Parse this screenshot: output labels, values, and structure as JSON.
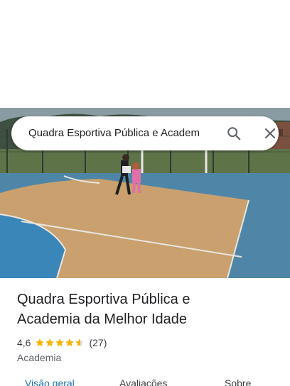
{
  "search": {
    "query": "Quadra Esportiva Pública e Academ"
  },
  "place": {
    "title_line1": "Quadra Esportiva Pública e",
    "title_line2": "Academia da Melhor Idade",
    "rating": "4,6",
    "stars": 4.6,
    "review_count": "(27)",
    "category": "Academia"
  },
  "tabs": [
    {
      "label": "Visão geral",
      "active": true
    },
    {
      "label": "Avaliações",
      "active": false
    },
    {
      "label": "Sobre",
      "active": false
    }
  ],
  "icons": {
    "search": "search-icon",
    "close": "close-icon",
    "star": "star-icon"
  },
  "colors": {
    "star": "#f4b400",
    "active_tab": "#1a73a8",
    "text": "#202124"
  }
}
